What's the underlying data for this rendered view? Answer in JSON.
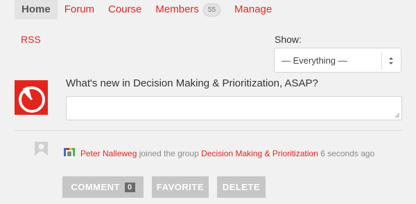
{
  "tabs": [
    {
      "label": "Home",
      "active": true
    },
    {
      "label": "Forum"
    },
    {
      "label": "Course"
    },
    {
      "label": "Members",
      "badge": "55"
    },
    {
      "label": "Manage"
    }
  ],
  "rss_label": "RSS",
  "filter": {
    "label": "Show:",
    "selected": "— Everything —"
  },
  "post_form": {
    "prompt": "What's new in Decision Making & Prioritization, ASAP?",
    "value": ""
  },
  "activity": {
    "user": "Peter Nalleweg",
    "action": " joined the group ",
    "group": "Decision Making & Prioritization",
    "time": " 6 seconds ago"
  },
  "buttons": {
    "comment": "COMMENT",
    "comment_count": "0",
    "favorite": "FAVORITE",
    "delete": "DELETE"
  },
  "colors": {
    "accent": "#e3251d",
    "background": "#f1f1f1",
    "button": "#c6c6c6"
  }
}
